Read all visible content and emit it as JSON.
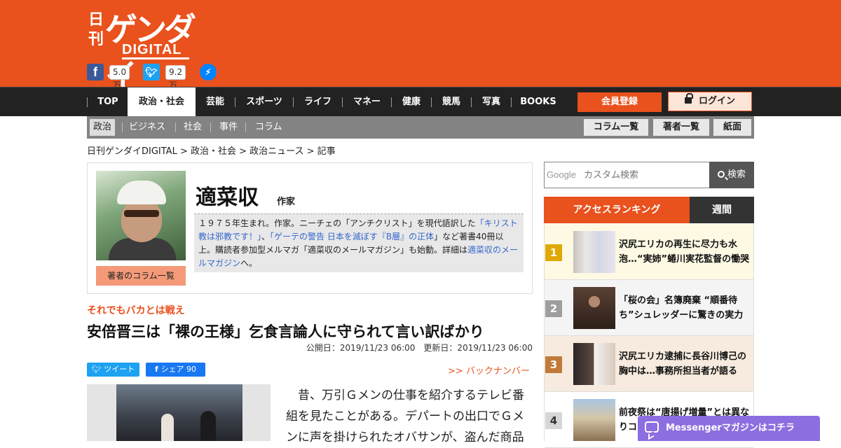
{
  "brand": {
    "logo_kanji": "日刊",
    "logo_main": "ゲンダイ",
    "logo_sub": "DIGITAL",
    "accent_color": "#e9511d"
  },
  "social": {
    "facebook_icon": "facebook-icon",
    "facebook_count": "5.0万",
    "twitter_icon": "twitter-icon",
    "twitter_count": "9.2万",
    "messenger_icon": "messenger-icon"
  },
  "nav": {
    "items": [
      "TOP",
      "政治・社会",
      "芸能",
      "スポーツ",
      "ライフ",
      "マネー",
      "健康",
      "競馬",
      "写真",
      "BOOKS"
    ],
    "active": "政治・社会",
    "register": "会員登録",
    "login": "ログイン"
  },
  "subnav": {
    "items": [
      "政治",
      "ビジネス",
      "社会",
      "事件",
      "コラム"
    ],
    "active": "政治",
    "buttons": [
      "コラム一覧",
      "著者一覧",
      "紙面"
    ]
  },
  "breadcrumb": "日刊ゲンダイDIGITAL > 政治・社会 > 政治ニュース > 記事",
  "author": {
    "name": "適菜収",
    "role": "作家",
    "bio_1": "１９７５年生まれ。作家。ニーチェの「アンチクリスト」を現代語訳した",
    "bio_link_1": "「キリスト教は邪教です！」",
    "bio_2": "、",
    "bio_link_2": "「ゲーテの警告 日本を滅ぼす『B層』の正体",
    "bio_3": "」など著書40冊以上。購読者参加型メルマガ「適菜収のメールマガジン」も始動。詳細は",
    "bio_link_3": "適菜収のメールマガジン",
    "bio_4": "へ。",
    "column_button": "著者のコラム一覧"
  },
  "article": {
    "kicker": "それでもバカとは戦え",
    "title": "安倍晋三は「裸の王様」乞食言論人に守られて言い訳ばかり",
    "published": "公開日：2019/11/23 06:00　更新日：2019/11/23 06:00",
    "tweet": "ツイート",
    "share": "シェア 90",
    "backnumber": ">> バックナンバー",
    "body": "昔、万引Ｇメンの仕事を紹介するテレビ番組を見たことがある。デパートの出口でＧメンに声を掛けられたオバサンが、盗んだ商品"
  },
  "search": {
    "google_label": "Google",
    "placeholder": "カスタム検索",
    "button": "検索"
  },
  "ranking": {
    "tab_access": "アクセスランキング",
    "tab_weekly": "週間",
    "items": [
      {
        "rank": "1",
        "title": "沢尻エリカの再生に尽力も水泡…“実姉”蜷川実花監督の慟哭",
        "color": "#e0a800",
        "bg": "#fdf9e3"
      },
      {
        "rank": "2",
        "title": "「桜の会」名簿廃棄 “順番待ち”シュレッダーに驚きの実力",
        "color": "#9e9e9e",
        "bg": "#f4f4f4"
      },
      {
        "rank": "3",
        "title": "沢尻エリカ逮捕に長谷川博己の胸中は…事務所担当者が語る",
        "color": "#c17a38",
        "bg": "#f6ebde"
      },
      {
        "rank": "4",
        "title": "前夜祭は“唐揚げ増量”とは異なりコスト…",
        "color": "#d6d6d6",
        "bg": "#ffffff"
      }
    ]
  },
  "messenger": {
    "label": "Messengerマガジンはコチラ"
  }
}
